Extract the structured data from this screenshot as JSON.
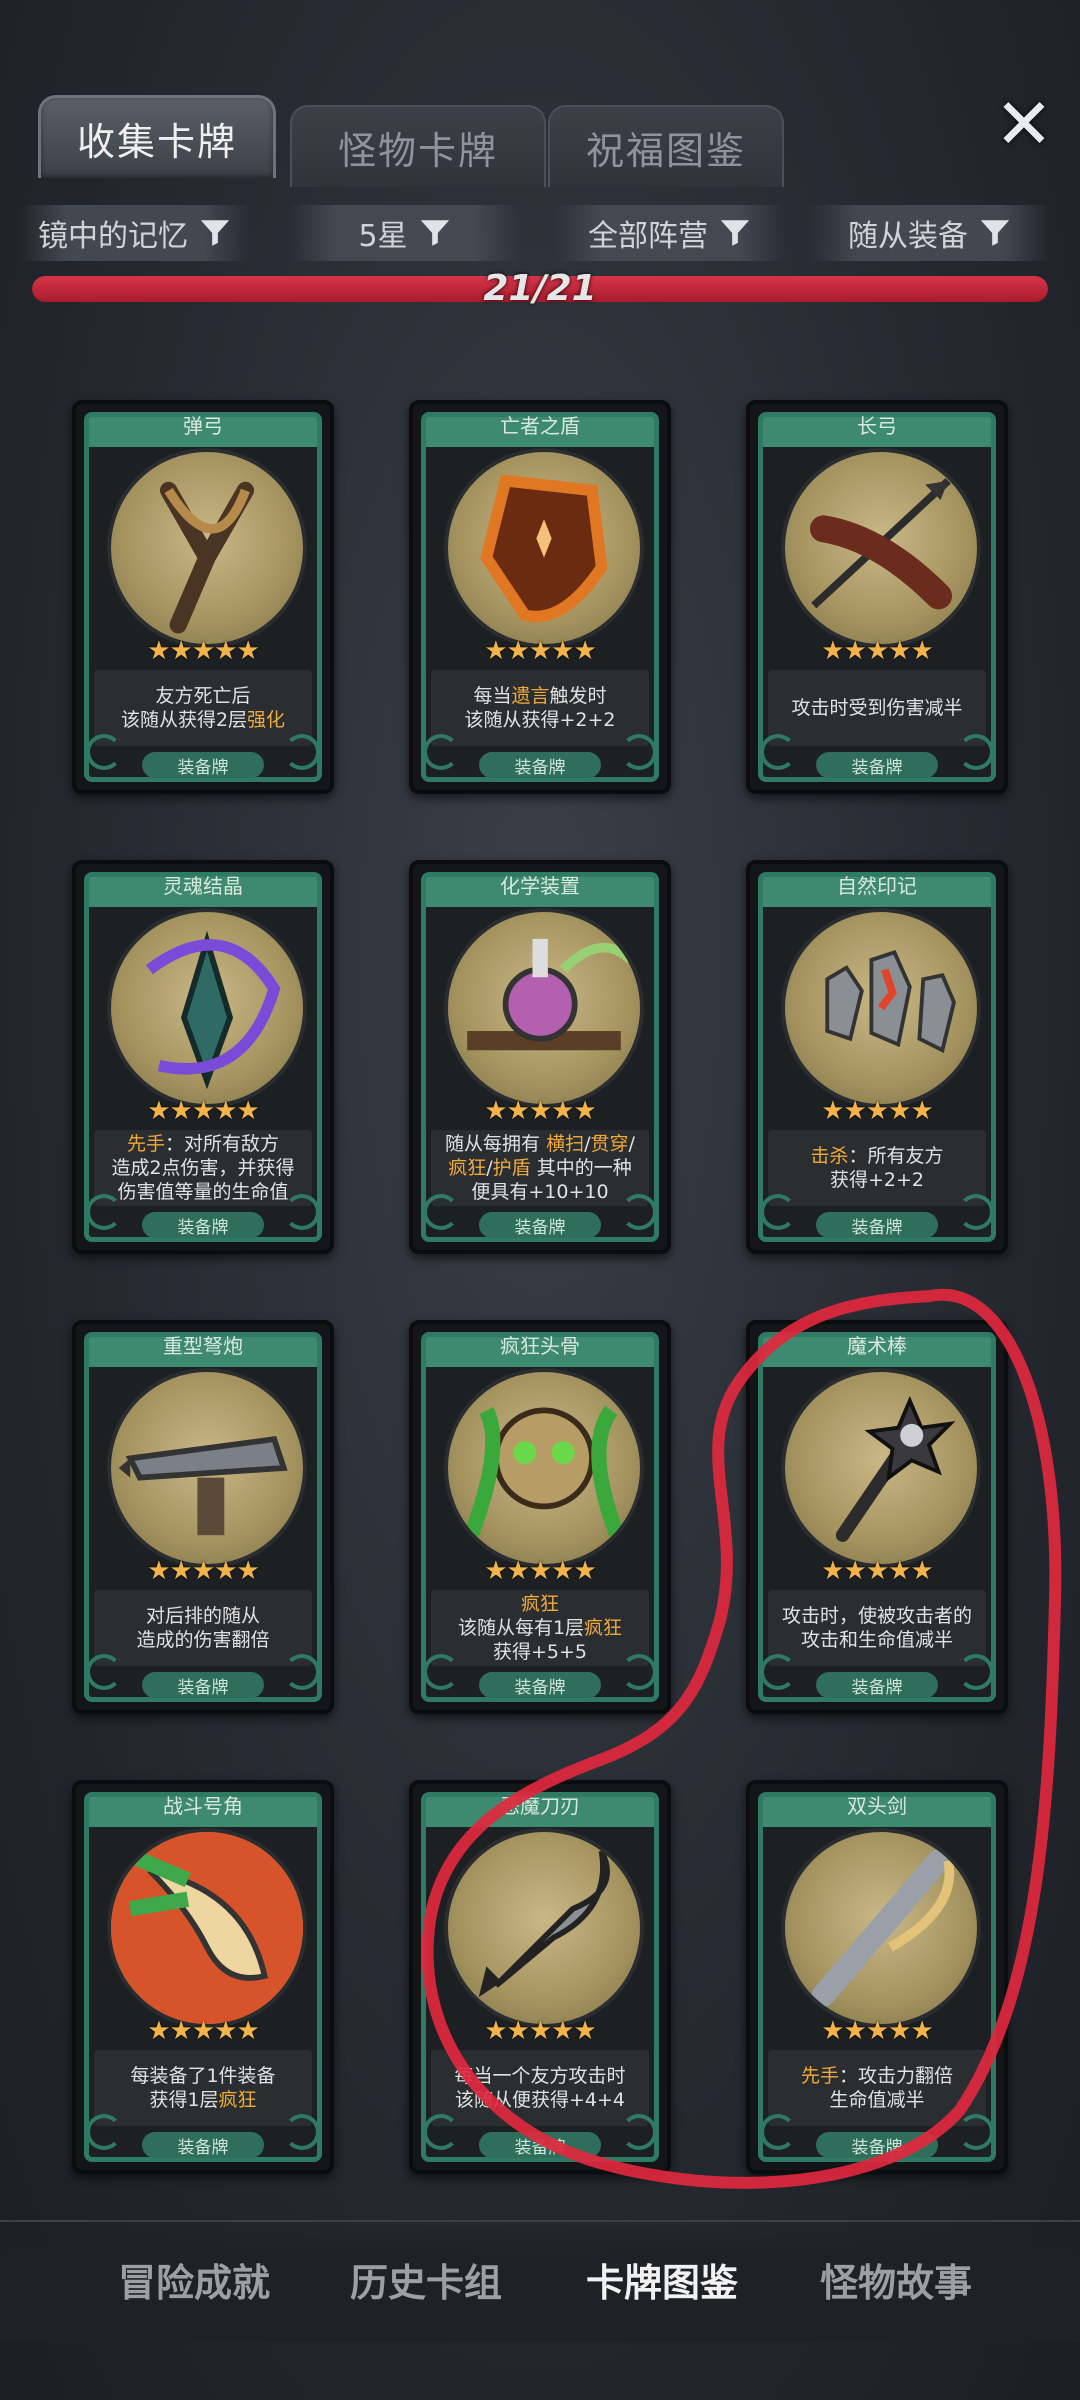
{
  "tabs": [
    {
      "label": "收集卡牌",
      "active": true
    },
    {
      "label": "怪物卡牌",
      "active": false
    },
    {
      "label": "祝福图鉴",
      "active": false
    }
  ],
  "filters": [
    {
      "label": "镜中的记忆"
    },
    {
      "label": "5星"
    },
    {
      "label": "全部阵营"
    },
    {
      "label": "随从装备"
    }
  ],
  "progress": {
    "text": "21/21",
    "fraction": 1.0
  },
  "cards": [
    {
      "title": "弹弓",
      "stars": "★★★★★",
      "desc_parts": [
        {
          "t": "友方死亡后\n该随从获得2层"
        },
        {
          "t": "强化",
          "hl": true
        }
      ],
      "badge": "装备牌",
      "icon": "slingshot-art"
    },
    {
      "title": "亡者之盾",
      "stars": "★★★★★",
      "desc_parts": [
        {
          "t": "每当"
        },
        {
          "t": "遗言",
          "hl": true
        },
        {
          "t": "触发时\n该随从获得+2+2"
        }
      ],
      "badge": "装备牌",
      "icon": "shield-art"
    },
    {
      "title": "长弓",
      "stars": "★★★★★",
      "desc_parts": [
        {
          "t": "攻击时受到伤害减半"
        }
      ],
      "badge": "装备牌",
      "icon": "longbow-art"
    },
    {
      "title": "灵魂结晶",
      "stars": "★★★★★",
      "desc_parts": [
        {
          "t": "先手",
          "hl": true
        },
        {
          "t": "：对所有敌方\n造成2点伤害，并获得\n伤害值等量的生命值"
        }
      ],
      "badge": "装备牌",
      "icon": "soul-crystal-art"
    },
    {
      "title": "化学装置",
      "stars": "★★★★★",
      "desc_parts": [
        {
          "t": "随从每拥有 "
        },
        {
          "t": "横扫",
          "hl": true
        },
        {
          "t": "/"
        },
        {
          "t": "贯穿",
          "hl": true
        },
        {
          "t": "/\n"
        },
        {
          "t": "疯狂",
          "hl": true
        },
        {
          "t": "/"
        },
        {
          "t": "护盾",
          "hl": true
        },
        {
          "t": " 其中的一种\n便具有+10+10"
        }
      ],
      "badge": "装备牌",
      "icon": "chemistry-art"
    },
    {
      "title": "自然印记",
      "stars": "★★★★★",
      "desc_parts": [
        {
          "t": "击杀",
          "hl": true
        },
        {
          "t": "：所有友方\n获得+2+2"
        }
      ],
      "badge": "装备牌",
      "icon": "nature-mark-art"
    },
    {
      "title": "重型弩炮",
      "stars": "★★★★★",
      "desc_parts": [
        {
          "t": "对后排的随从\n造成的伤害翻倍"
        }
      ],
      "badge": "装备牌",
      "icon": "ballista-art"
    },
    {
      "title": "疯狂头骨",
      "stars": "★★★★★",
      "desc_parts": [
        {
          "t": "疯狂",
          "hl": true
        },
        {
          "t": "\n该随从每有1层"
        },
        {
          "t": "疯狂",
          "hl": true
        },
        {
          "t": "\n获得+5+5"
        }
      ],
      "badge": "装备牌",
      "icon": "mad-skull-art"
    },
    {
      "title": "魔术棒",
      "stars": "★★★★★",
      "desc_parts": [
        {
          "t": "攻击时，使被攻击者的\n攻击和生命值减半"
        }
      ],
      "badge": "装备牌",
      "icon": "magic-wand-art"
    },
    {
      "title": "战斗号角",
      "stars": "★★★★★",
      "desc_parts": [
        {
          "t": "每装备了1件装备\n获得1层"
        },
        {
          "t": "疯狂",
          "hl": true
        }
      ],
      "badge": "装备牌",
      "icon": "war-horn-art"
    },
    {
      "title": "恶魔刀刃",
      "stars": "★★★★★",
      "desc_parts": [
        {
          "t": "每当一个友方攻击时\n该随从便获得+4+4"
        }
      ],
      "badge": "装备牌",
      "icon": "demon-blade-art"
    },
    {
      "title": "双头剑",
      "stars": "★★★★★",
      "desc_parts": [
        {
          "t": "先手",
          "hl": true
        },
        {
          "t": "：攻击力翻倍\n生命值减半"
        }
      ],
      "badge": "装备牌",
      "icon": "double-sword-art"
    }
  ],
  "bottom_nav": [
    {
      "label": "冒险成就",
      "active": false
    },
    {
      "label": "历史卡组",
      "active": false
    },
    {
      "label": "卡牌图鉴",
      "active": true
    },
    {
      "label": "怪物故事",
      "active": false
    }
  ],
  "colors": {
    "accent": "#2f7a62",
    "highlight": "#f0a93b",
    "progress": "#d8344a",
    "annotation": "#e0283e"
  }
}
